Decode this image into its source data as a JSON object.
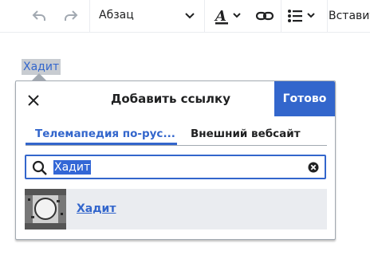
{
  "toolbar": {
    "paragraph_label": "Абзац",
    "insert_label": "Вставить"
  },
  "content": {
    "selected_word": "Хадит"
  },
  "link_dialog": {
    "title": "Добавить ссылку",
    "done_label": "Готово",
    "tabs": [
      {
        "label": "Телемапедия по-рус...",
        "active": true
      },
      {
        "label": "Внешний вебсайт",
        "active": false
      }
    ],
    "search_value": "Хадит",
    "results": [
      {
        "label": "Хадит"
      }
    ]
  },
  "colors": {
    "accent": "#3366cc",
    "selection": "#3367d6",
    "result_bg": "#eaecf0"
  }
}
